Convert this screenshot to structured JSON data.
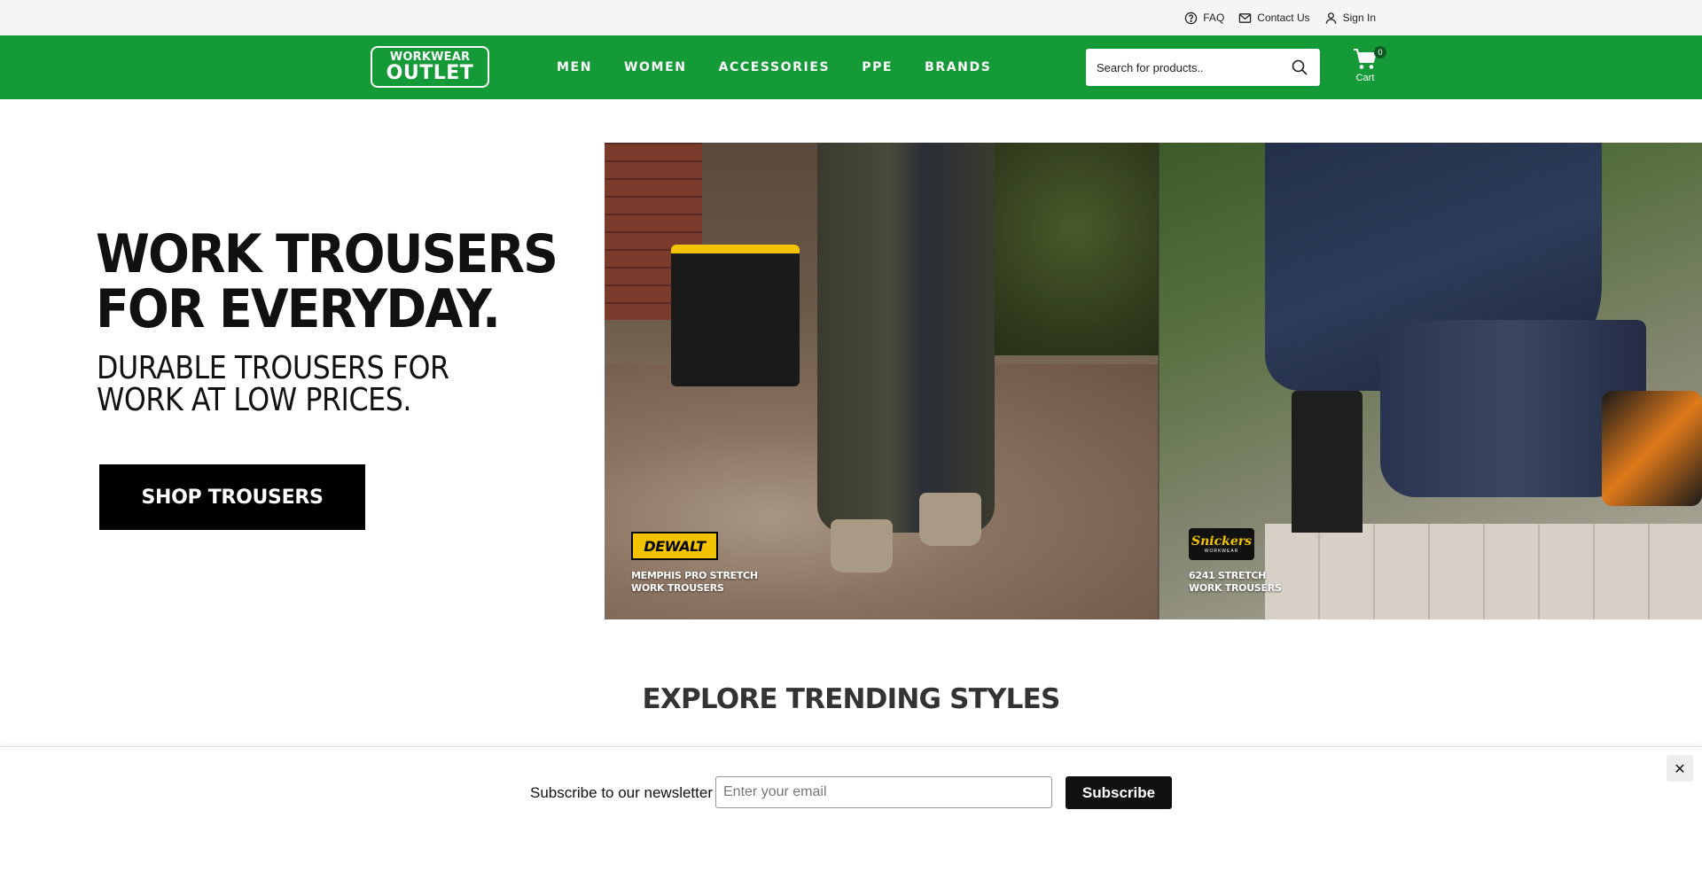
{
  "utility_bar": {
    "links": [
      {
        "label": "FAQ",
        "icon": "question-circle-icon"
      },
      {
        "label": "Contact Us",
        "icon": "envelope-icon"
      },
      {
        "label": "Sign In",
        "icon": "user-icon"
      }
    ]
  },
  "header": {
    "logo_line1": "WORKWEAR",
    "logo_line2": "OUTLET",
    "nav": [
      "MEN",
      "WOMEN",
      "ACCESSORIES",
      "PPE",
      "BRANDS"
    ],
    "search_placeholder": "Search for products..",
    "cart_label": "Cart",
    "cart_count": "0",
    "brand_color": "#159a38"
  },
  "hero": {
    "heading_line1": "WORK TROUSERS",
    "heading_line2": "FOR EVERYDAY.",
    "subheading_line1": "DURABLE TROUSERS FOR",
    "subheading_line2": "WORK AT LOW PRICES.",
    "cta_label": "SHOP TROUSERS",
    "left_panel": {
      "brand": "DEWALT",
      "caption": "MEMPHIS PRO STRETCH\nWORK TROUSERS"
    },
    "right_panel": {
      "brand": "Snickers",
      "brand_sub": "WORKWEAR",
      "caption": "6241 STRETCH\nWORK TROUSERS"
    }
  },
  "trending": {
    "title": "EXPLORE TRENDING STYLES"
  },
  "newsletter": {
    "label": "Subscribe to our newsletter",
    "email_placeholder": "Enter your email",
    "button_label": "Subscribe",
    "close_symbol": "✕"
  }
}
